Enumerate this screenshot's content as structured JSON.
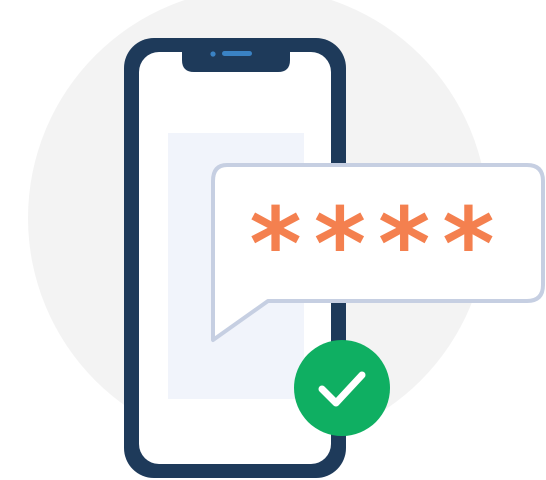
{
  "illustration": {
    "password_mask": "****",
    "colors": {
      "background_circle": "#f3f3f3",
      "phone_frame": "#1e3a5a",
      "phone_screen": "#ffffff",
      "screen_panel": "#f1f4fb",
      "bubble_border": "#c6cfe2",
      "bubble_fill": "#ffffff",
      "asterisk": "#f4804f",
      "check_circle": "#0faf62",
      "check_mark": "#ffffff"
    },
    "icons": [
      "smartphone-icon",
      "speech-bubble-icon",
      "asterisk-icon",
      "check-circle-icon"
    ]
  }
}
